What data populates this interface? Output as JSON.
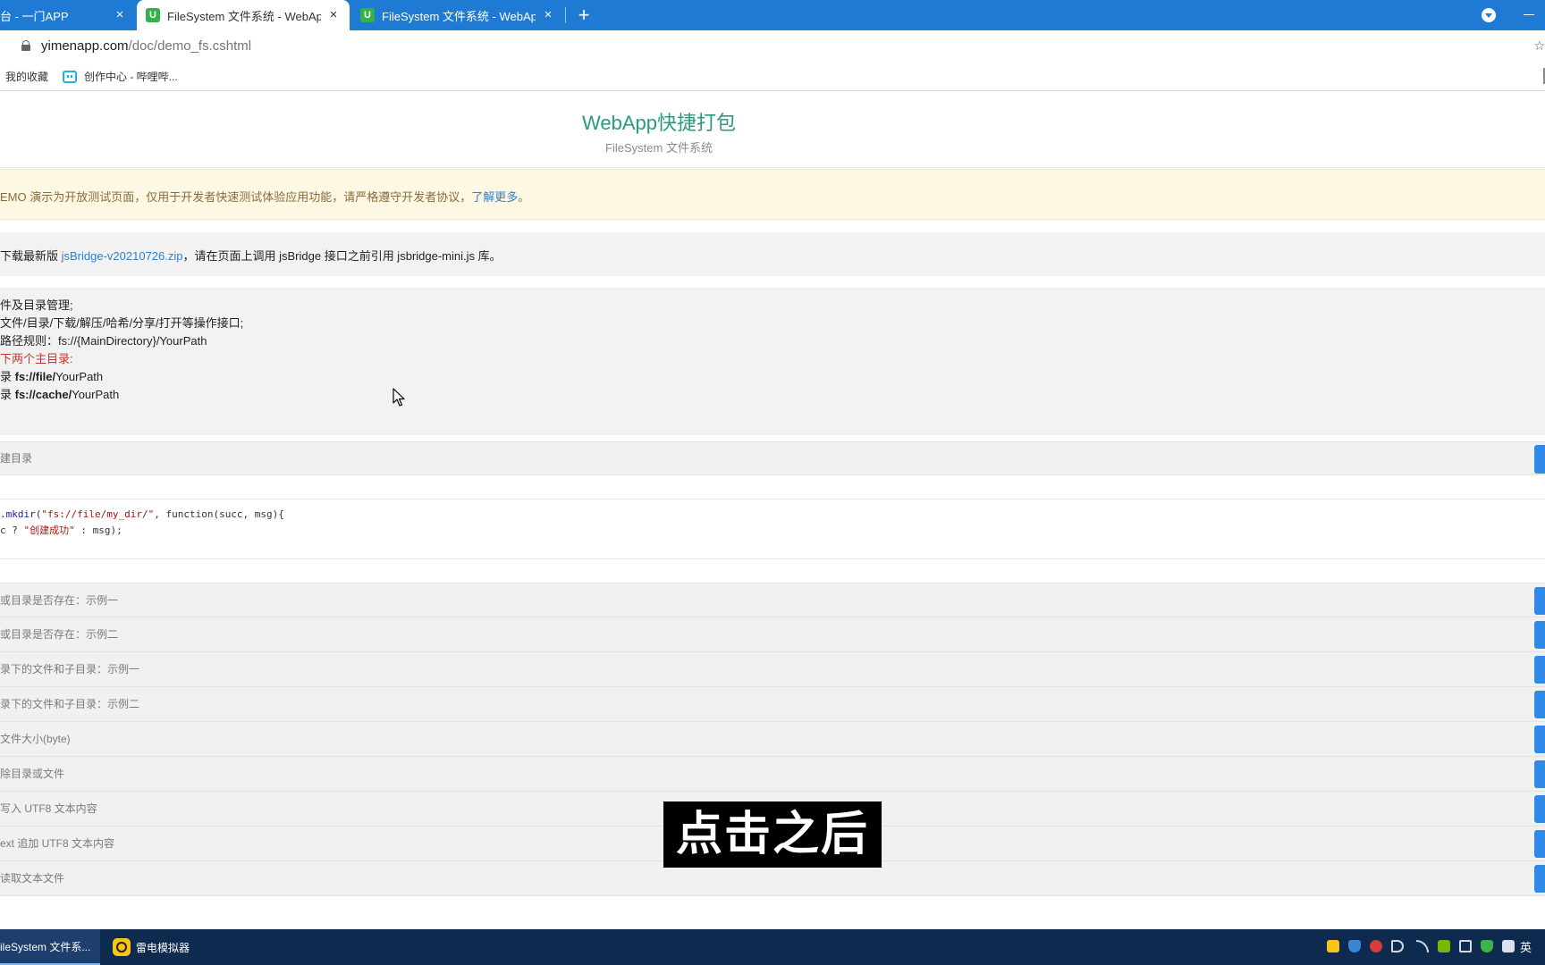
{
  "browser": {
    "tabs": [
      {
        "title": "台 - 一门APP",
        "active": false
      },
      {
        "title": "FileSystem 文件系统 - WebApp",
        "active": true
      },
      {
        "title": "FileSystem 文件系统 - WebApp",
        "active": false
      }
    ],
    "favicon_letter": "U",
    "new_tab_label": "+",
    "close_label": "×",
    "url_host": "yimenapp.com",
    "url_path": "/doc/demo_fs.cshtml",
    "bookmarks": [
      {
        "label": "我的收藏"
      },
      {
        "label": "创作中心 - 哔哩哔..."
      }
    ]
  },
  "page": {
    "title": "WebApp快捷打包",
    "subtitle": "FileSystem 文件系统",
    "notice": {
      "text": "EMO 演示为开放测试页面，仅用于开发者快速测试体验应用功能，请严格遵守开发者协议，",
      "link": "了解更多",
      "tail": "。"
    },
    "download": {
      "prefix": "下载最新版 ",
      "link": "jsBridge-v20210726.zip",
      "suffix": "，请在页面上调用 jsBridge 接口之前引用 jsbridge-mini.js 库。"
    },
    "intro": {
      "line1": "件及目录管理;",
      "line2": "文件/目录/下载/解压/哈希/分享/打开等操作接口;",
      "line3": "路径规则：fs://{MainDirectory}/YourPath",
      "line4": "下两个主目录:",
      "line5_prefix": "录 ",
      "line5_bold": "fs://file/",
      "line5_suffix": "YourPath",
      "line6_prefix": "录 ",
      "line6_bold": "fs://cache/",
      "line6_suffix": "YourPath"
    },
    "first_panel": "建目录",
    "code": {
      "l1_fn": ".mkdir",
      "l1_open": "(",
      "l1_str": "\"fs://file/my_dir/\"",
      "l1_rest": ", function(succ, msg){",
      "l2_a": "c ? ",
      "l2_str": "\"创建成功\"",
      "l2_b": " : msg);"
    },
    "panels": [
      {
        "label": "或目录是否存在：示例一"
      },
      {
        "label": "或目录是否存在：示例二"
      },
      {
        "label": "录下的文件和子目录：示例一"
      },
      {
        "label": "录下的文件和子目录：示例二"
      },
      {
        "label": "文件大小(byte)"
      },
      {
        "label": "除目录或文件"
      },
      {
        "label": "写入 UTF8 文本内容"
      },
      {
        "label": "ext 追加 UTF8 文本内容"
      },
      {
        "label": "读取文本文件"
      }
    ]
  },
  "video_subtitle": "点击之后",
  "taskbar": {
    "items": [
      {
        "label": "ileSystem 文件系...",
        "active": true
      },
      {
        "label": "雷电模拟器",
        "active": false
      }
    ],
    "language": "英"
  },
  "colors": {
    "tabbar": "#1f7ad3",
    "accent_title": "#2a9a7c",
    "link": "#2f80c8",
    "notice_bg": "#fcf8e3",
    "run_button": "#2e8ae6",
    "taskbar": "#0f2a4f"
  },
  "icons": [
    "lock-icon",
    "star-icon",
    "bilibili-icon",
    "mouse-cursor-icon",
    "ldplayer-icon",
    "tab-dropdown-icon"
  ]
}
